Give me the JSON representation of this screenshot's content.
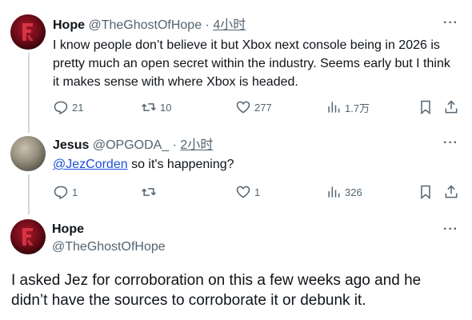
{
  "tweet1": {
    "name": "Hope",
    "handle": "@TheGhostOfHope",
    "time": "4小时",
    "text": "I know people don’t believe it but Xbox next console being in 2026 is pretty much an open secret within the industry. Seems early but I think it makes sense with where Xbox is headed.",
    "replies": "21",
    "retweets": "10",
    "likes": "277",
    "views": "1.7万"
  },
  "tweet2": {
    "name": "Jesus",
    "handle": "@OPGODA_",
    "time": "2小时",
    "mention": "@JezCorden",
    "text": " so it's happening?",
    "replies": "1",
    "likes": "1",
    "views": "326"
  },
  "tweet3": {
    "name": "Hope",
    "handle": "@TheGhostOfHope",
    "text": "I asked Jez for corroboration on this a few weeks ago and he didn’t have the sources to corroborate it or debunk it."
  },
  "ui": {
    "more_label": "···",
    "separator": " · ",
    "icons": [
      "reply-icon",
      "retweet-icon",
      "like-icon",
      "views-icon",
      "bookmark-icon",
      "share-icon",
      "more-icon"
    ]
  }
}
